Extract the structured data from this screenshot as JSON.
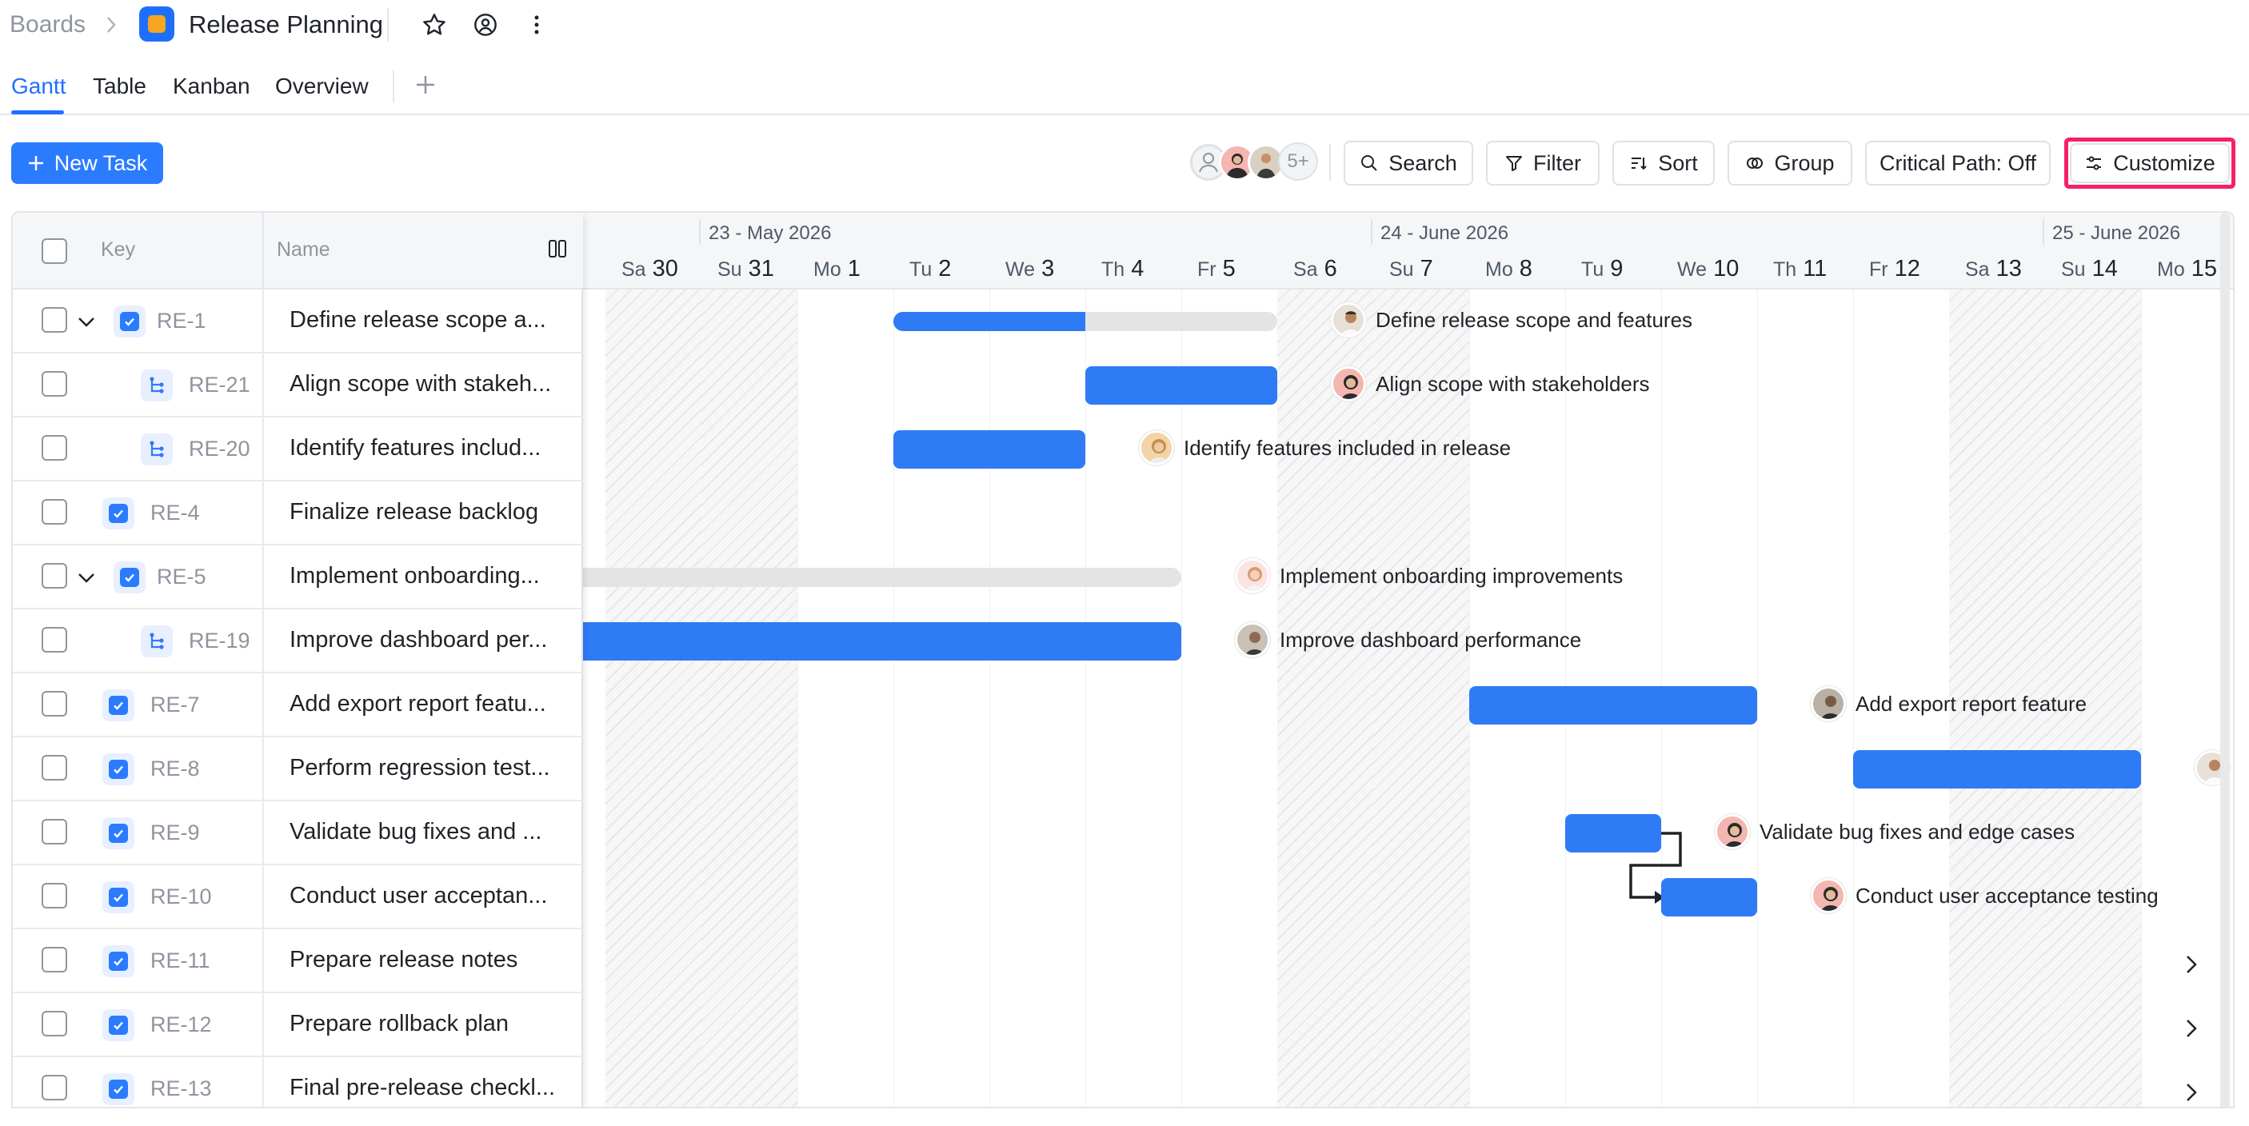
{
  "breadcrumb": {
    "root": "Boards"
  },
  "page": {
    "title": "Release Planning"
  },
  "tabs": [
    {
      "label": "Gantt",
      "active": true
    },
    {
      "label": "Table"
    },
    {
      "label": "Kanban"
    },
    {
      "label": "Overview"
    }
  ],
  "toolbar": {
    "new_task": "New Task",
    "avatars_more": "5+",
    "search": "Search",
    "filter": "Filter",
    "sort": "Sort",
    "group": "Group",
    "critical_path": "Critical Path: Off",
    "customize": "Customize"
  },
  "table": {
    "headers": {
      "key": "Key",
      "name": "Name"
    },
    "rows": [
      {
        "key": "RE-1",
        "name": "Define release scope a...",
        "level": 0,
        "expandable": true
      },
      {
        "key": "RE-21",
        "name": "Align scope with stakeh...",
        "level": 1
      },
      {
        "key": "RE-20",
        "name": "Identify features includ...",
        "level": 1
      },
      {
        "key": "RE-4",
        "name": "Finalize release backlog",
        "level": 0
      },
      {
        "key": "RE-5",
        "name": "Implement onboarding...",
        "level": 0,
        "expandable": true
      },
      {
        "key": "RE-19",
        "name": "Improve dashboard per...",
        "level": 1
      },
      {
        "key": "RE-7",
        "name": "Add export report featu...",
        "level": 0
      },
      {
        "key": "RE-8",
        "name": "Perform regression test...",
        "level": 0
      },
      {
        "key": "RE-9",
        "name": "Validate bug fixes and ...",
        "level": 0
      },
      {
        "key": "RE-10",
        "name": "Conduct user acceptan...",
        "level": 0
      },
      {
        "key": "RE-11",
        "name": "Prepare release notes",
        "level": 0
      },
      {
        "key": "RE-12",
        "name": "Prepare rollback plan",
        "level": 0
      },
      {
        "key": "RE-13",
        "name": "Final pre-release checkl...",
        "level": 0
      }
    ]
  },
  "timeline": {
    "months": [
      "23 - May 2026",
      "24 - June 2026",
      "25 - June 2026"
    ],
    "days": [
      {
        "dow": "Sa",
        "num": "30"
      },
      {
        "dow": "Su",
        "num": "31"
      },
      {
        "dow": "Mo",
        "num": "1"
      },
      {
        "dow": "Tu",
        "num": "2"
      },
      {
        "dow": "We",
        "num": "3"
      },
      {
        "dow": "Th",
        "num": "4"
      },
      {
        "dow": "Fr",
        "num": "5"
      },
      {
        "dow": "Sa",
        "num": "6"
      },
      {
        "dow": "Su",
        "num": "7"
      },
      {
        "dow": "Mo",
        "num": "8"
      },
      {
        "dow": "Tu",
        "num": "9"
      },
      {
        "dow": "We",
        "num": "10"
      },
      {
        "dow": "Th",
        "num": "11"
      },
      {
        "dow": "Fr",
        "num": "12"
      },
      {
        "dow": "Sa",
        "num": "13"
      },
      {
        "dow": "Su",
        "num": "14"
      },
      {
        "dow": "Mo",
        "num": "15"
      }
    ],
    "bar_labels": {
      "re1": "Define release scope and features",
      "re21": "Align scope with stakeholders",
      "re20": "Identify features included in release",
      "re5": "Implement onboarding improvements",
      "re19": "Improve dashboard performance",
      "re7": "Add export report feature",
      "re9": "Validate bug fixes and edge cases",
      "re10": "Conduct user acceptance testing"
    },
    "progress": {
      "re1": 0.5,
      "re5": 0
    }
  },
  "colors": {
    "accent": "#1f6fff",
    "bar": "#2f7bf5",
    "highlight": "#f5206a"
  }
}
